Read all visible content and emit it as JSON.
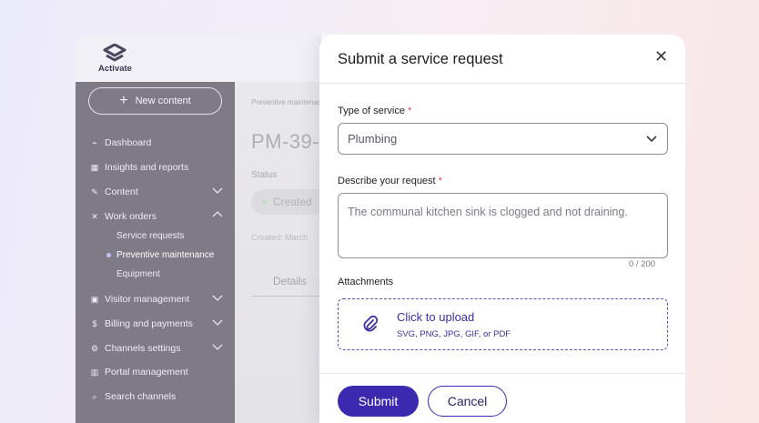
{
  "app": {
    "logo_text": "Activate"
  },
  "sidebar": {
    "new_content_label": "New content",
    "items": [
      {
        "label": "Dashboard",
        "icon": "pulse-icon",
        "expandable": false
      },
      {
        "label": "Insights and reports",
        "icon": "chart-icon",
        "expandable": false
      },
      {
        "label": "Content",
        "icon": "edit-icon",
        "expandable": true,
        "expanded": false
      },
      {
        "label": "Work orders",
        "icon": "tools-icon",
        "expandable": true,
        "expanded": true
      },
      {
        "label": "Visitor management",
        "icon": "badge-icon",
        "expandable": true,
        "expanded": false
      },
      {
        "label": "Billing and payments",
        "icon": "dollar-icon",
        "expandable": true,
        "expanded": false
      },
      {
        "label": "Channels settings",
        "icon": "gear-icon",
        "expandable": true,
        "expanded": false
      },
      {
        "label": "Portal management",
        "icon": "building-icon",
        "expandable": false
      },
      {
        "label": "Search channels",
        "icon": "search-icon",
        "expandable": false
      }
    ],
    "work_orders_sub": [
      {
        "label": "Service requests",
        "active": false
      },
      {
        "label": "Preventive maintenance",
        "active": true
      },
      {
        "label": "Equipment",
        "active": false
      }
    ]
  },
  "main": {
    "breadcrumb": "Preventive maintenance",
    "title": "PM-39-",
    "status_label": "Status",
    "status_value": "Created",
    "created_meta": "Created: March",
    "tab_details": "Details"
  },
  "modal": {
    "title": "Submit a service request",
    "close_symbol": "✕",
    "type_label": "Type of service",
    "required_mark": "*",
    "type_value": "Plumbing",
    "describe_label": "Describe your request",
    "describe_value": "The communal kitchen sink is clogged and not draining.",
    "counter": "0 / 200",
    "attachments_label": "Attachments",
    "upload_title": "Click to upload",
    "upload_types": "SVG, PNG, JPG, GIF, or PDF",
    "submit_label": "Submit",
    "cancel_label": "Cancel"
  },
  "colors": {
    "accent": "#3b2ab0",
    "sidebar_bg": "#7e7a86",
    "required": "#e0424c"
  }
}
